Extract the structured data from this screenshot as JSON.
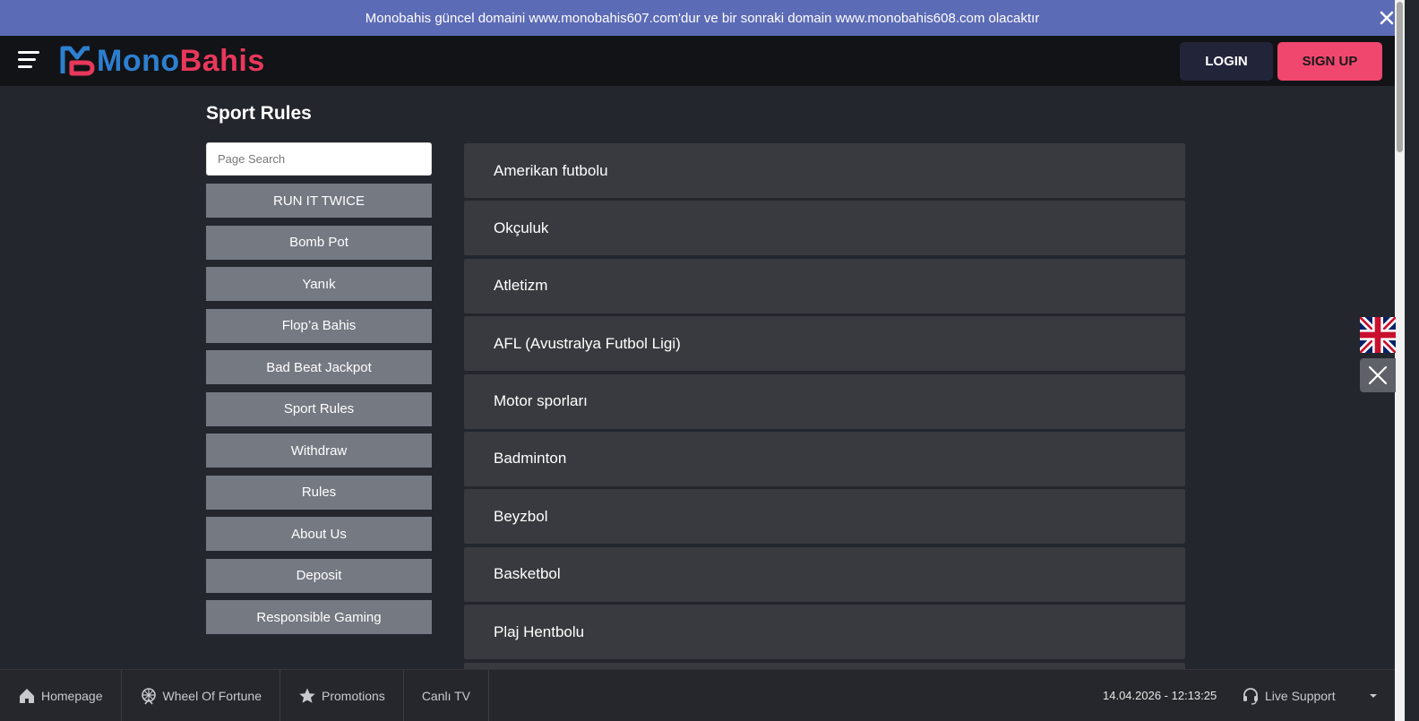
{
  "announcement": {
    "text": "Monobahis güncel domaini www.monobahis607.com'dur ve bir sonraki domain www.monobahis608.com olacaktır",
    "close_icon": "close-icon"
  },
  "header": {
    "logo_mono": "Mono",
    "logo_bahis": "Bahis",
    "login_label": "LOGIN",
    "signup_label": "SIGN UP"
  },
  "page": {
    "title": "Sport Rules",
    "search_placeholder": "Page Search"
  },
  "menu": [
    {
      "label": "RUN IT TWICE"
    },
    {
      "label": "Bomb Pot"
    },
    {
      "label": "Yanık"
    },
    {
      "label": "Flop’a Bahis"
    },
    {
      "label": "Bad Beat Jackpot"
    },
    {
      "label": "Sport Rules"
    },
    {
      "label": "Withdraw"
    },
    {
      "label": "Rules"
    },
    {
      "label": "About Us"
    },
    {
      "label": "Deposit"
    },
    {
      "label": "Responsible Gaming"
    }
  ],
  "rules": [
    {
      "label": "Amerikan futbolu"
    },
    {
      "label": "Okçuluk"
    },
    {
      "label": "Atletizm"
    },
    {
      "label": "AFL (Avustralya Futbol Ligi)"
    },
    {
      "label": "Motor sporları"
    },
    {
      "label": "Badminton"
    },
    {
      "label": "Beyzbol"
    },
    {
      "label": "Basketbol"
    },
    {
      "label": "Plaj Hentbolu"
    },
    {
      "label": ""
    }
  ],
  "bottombar": {
    "homepage": "Homepage",
    "wheel": "Wheel Of Fortune",
    "promotions": "Promotions",
    "canli_tv": "Canlı TV",
    "datetime": "14.04.2026 - 12:13:25",
    "support": "Live Support"
  },
  "colors": {
    "announcement_bg": "#5c6bb6",
    "signup_bg": "#f0476e",
    "login_bg": "#22243a",
    "logo_blue": "#2d7fd0",
    "logo_red": "#e8385c"
  }
}
